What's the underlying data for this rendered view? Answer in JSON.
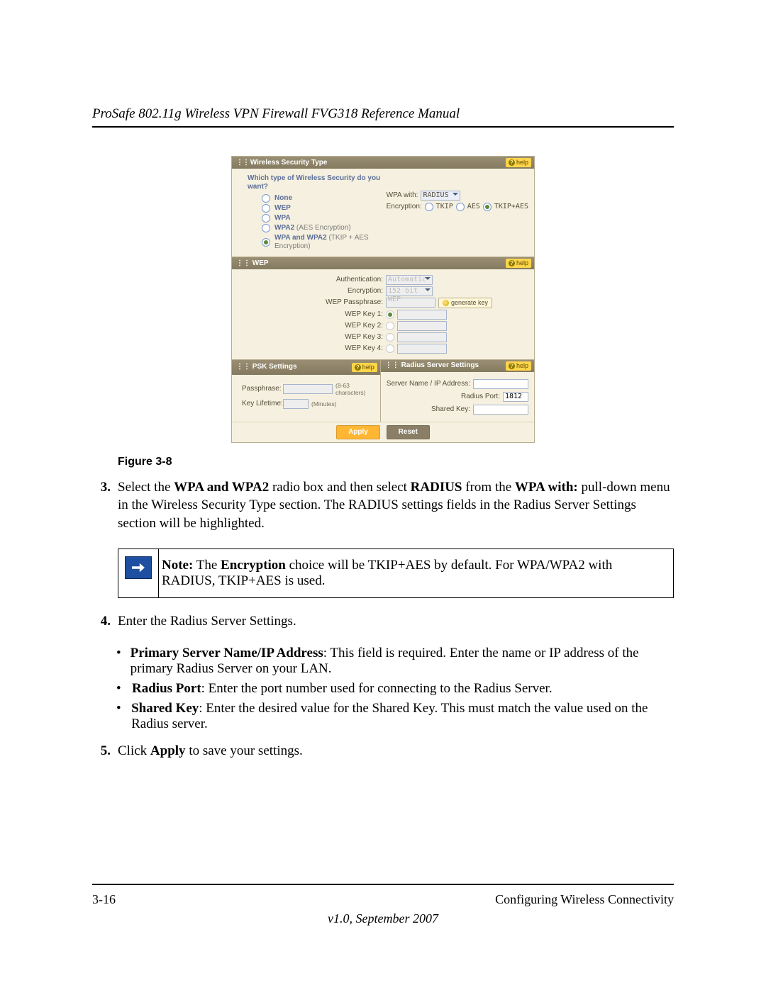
{
  "header": {
    "title": "ProSafe 802.11g Wireless VPN Firewall FVG318 Reference Manual"
  },
  "ui": {
    "help_label": "help",
    "security_type": {
      "title": "Wireless Security Type",
      "question": "Which type of Wireless Security do you want?",
      "options": {
        "none": "None",
        "wep": "WEP",
        "wpa": "WPA",
        "wpa2_label": "WPA2",
        "wpa2_note": " (AES Encryption)",
        "wpaboth_label": "WPA and WPA2",
        "wpaboth_note": " (TKIP + AES Encryption)"
      },
      "right": {
        "wpa_with_label": "WPA with:",
        "wpa_with_value": "RADIUS",
        "encryption_label": "Encryption:",
        "enc_tkip": "TKIP",
        "enc_aes": "AES",
        "enc_both": "TKIP+AES"
      }
    },
    "wep": {
      "title": "WEP",
      "auth_label": "Authentication:",
      "auth_value": "Automatic",
      "enc_label": "Encryption:",
      "enc_value": "152 bit WEP",
      "pass_label": "WEP Passphrase:",
      "gen_label": "generate key",
      "k1": "WEP Key 1:",
      "k2": "WEP Key 2:",
      "k3": "WEP Key 3:",
      "k4": "WEP Key 4:"
    },
    "psk": {
      "title": "PSK Settings",
      "pass_label": "Passphrase:",
      "pass_note": "(8-63 characters)",
      "life_label": "Key Lifetime:",
      "life_value": "",
      "life_unit": "(Minutes)"
    },
    "radius": {
      "title": "Radius Server Settings",
      "server_label": "Server Name / IP Address:",
      "port_label": "Radius Port:",
      "port_value": "1812",
      "key_label": "Shared Key:"
    },
    "buttons": {
      "apply": "Apply",
      "reset": "Reset"
    }
  },
  "caption": "Figure 3-8",
  "step3": {
    "num": "3.",
    "p1a": "Select the ",
    "p1b": "WPA and WPA2",
    "p1c": " radio box and then select ",
    "p1d": "RADIUS",
    "p1e": " from the ",
    "p1f": "WPA with:",
    "p1g": " pull-down menu in the Wireless Security Type section. The RADIUS settings fields in the Radius Server Settings section will be highlighted."
  },
  "note": {
    "n1": "Note:",
    "n2": " The ",
    "n3": "Encryption",
    "n4": " choice will be TKIP+AES by default. For WPA/WPA2 with RADIUS, TKIP+AES is used."
  },
  "step4": {
    "num": "4.",
    "text": "Enter the Radius Server Settings."
  },
  "b1": {
    "t1": "Primary Server Name/IP Address",
    "t2": ": This field is required. Enter the name or IP address of the primary Radius Server on your LAN."
  },
  "b2": {
    "t1": "Radius Port",
    "t2": ": Enter the port number used for connecting to the Radius Server."
  },
  "b3": {
    "t1": "Shared Key",
    "t2": ": Enter the desired value for the Shared Key. This must match the value used on the Radius server."
  },
  "step5": {
    "num": "5.",
    "t1": "Click ",
    "t2": "Apply",
    "t3": " to save your settings."
  },
  "footer": {
    "page": "3-16",
    "section": "Configuring Wireless Connectivity",
    "version": "v1.0, September 2007"
  }
}
